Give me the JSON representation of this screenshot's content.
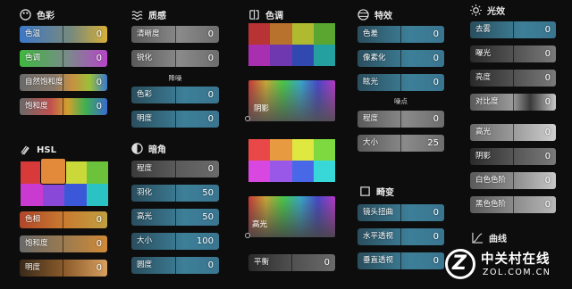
{
  "col1": {
    "color_header": "色彩",
    "sliders": [
      {
        "label": "色温",
        "value": "0"
      },
      {
        "label": "色调",
        "value": "0"
      },
      {
        "label": "自然饱和度",
        "value": "0"
      },
      {
        "label": "饱和度",
        "value": "0"
      }
    ],
    "hsl_header": "HSL",
    "hsl_sliders": [
      {
        "label": "色相",
        "value": "0"
      },
      {
        "label": "饱和度",
        "value": "0"
      },
      {
        "label": "明度",
        "value": "0"
      }
    ]
  },
  "col2": {
    "texture_header": "质感",
    "sliders_top": [
      {
        "label": "清晰度",
        "value": "0"
      },
      {
        "label": "锐化",
        "value": "0"
      }
    ],
    "denoise_label": "降噪",
    "sliders_denoise": [
      {
        "label": "色彩",
        "value": "0"
      },
      {
        "label": "明度",
        "value": "0"
      }
    ],
    "vignette_header": "暗角",
    "vignette_sliders": [
      {
        "label": "程度",
        "value": "0"
      },
      {
        "label": "羽化",
        "value": "50"
      },
      {
        "label": "高光",
        "value": "50"
      },
      {
        "label": "大小",
        "value": "100"
      },
      {
        "label": "圆度",
        "value": "0"
      }
    ]
  },
  "col3": {
    "header": "色调",
    "shadow_label": "阴影",
    "highlight_label": "高光",
    "balance": {
      "label": "平衡",
      "value": "0"
    }
  },
  "col4": {
    "effects_header": "特效",
    "effects_sliders": [
      {
        "label": "色差",
        "value": "0"
      },
      {
        "label": "像素化",
        "value": "0"
      },
      {
        "label": "眩光",
        "value": "0"
      }
    ],
    "grain_label": "噪点",
    "grain_sliders": [
      {
        "label": "程度",
        "value": "0"
      },
      {
        "label": "大小",
        "value": "25"
      }
    ],
    "distort_header": "畸变",
    "distort_sliders": [
      {
        "label": "镜头扭曲",
        "value": "0"
      },
      {
        "label": "水平透视",
        "value": "0"
      },
      {
        "label": "垂直透视",
        "value": "0"
      }
    ]
  },
  "col5": {
    "light_header": "光效",
    "sliders": [
      {
        "label": "去雾",
        "value": "0"
      },
      {
        "label": "曝光",
        "value": "0"
      },
      {
        "label": "亮度",
        "value": "0"
      },
      {
        "label": "对比度",
        "value": "0"
      },
      {
        "label": "高光",
        "value": "0"
      },
      {
        "label": "阴影",
        "value": "0"
      },
      {
        "label": "白色色阶",
        "value": "0"
      },
      {
        "label": "黑色色阶",
        "value": "0"
      }
    ],
    "curve_header": "曲线"
  },
  "watermark": {
    "cn": "中关村在线",
    "en": "ZOL.COM.CN"
  }
}
